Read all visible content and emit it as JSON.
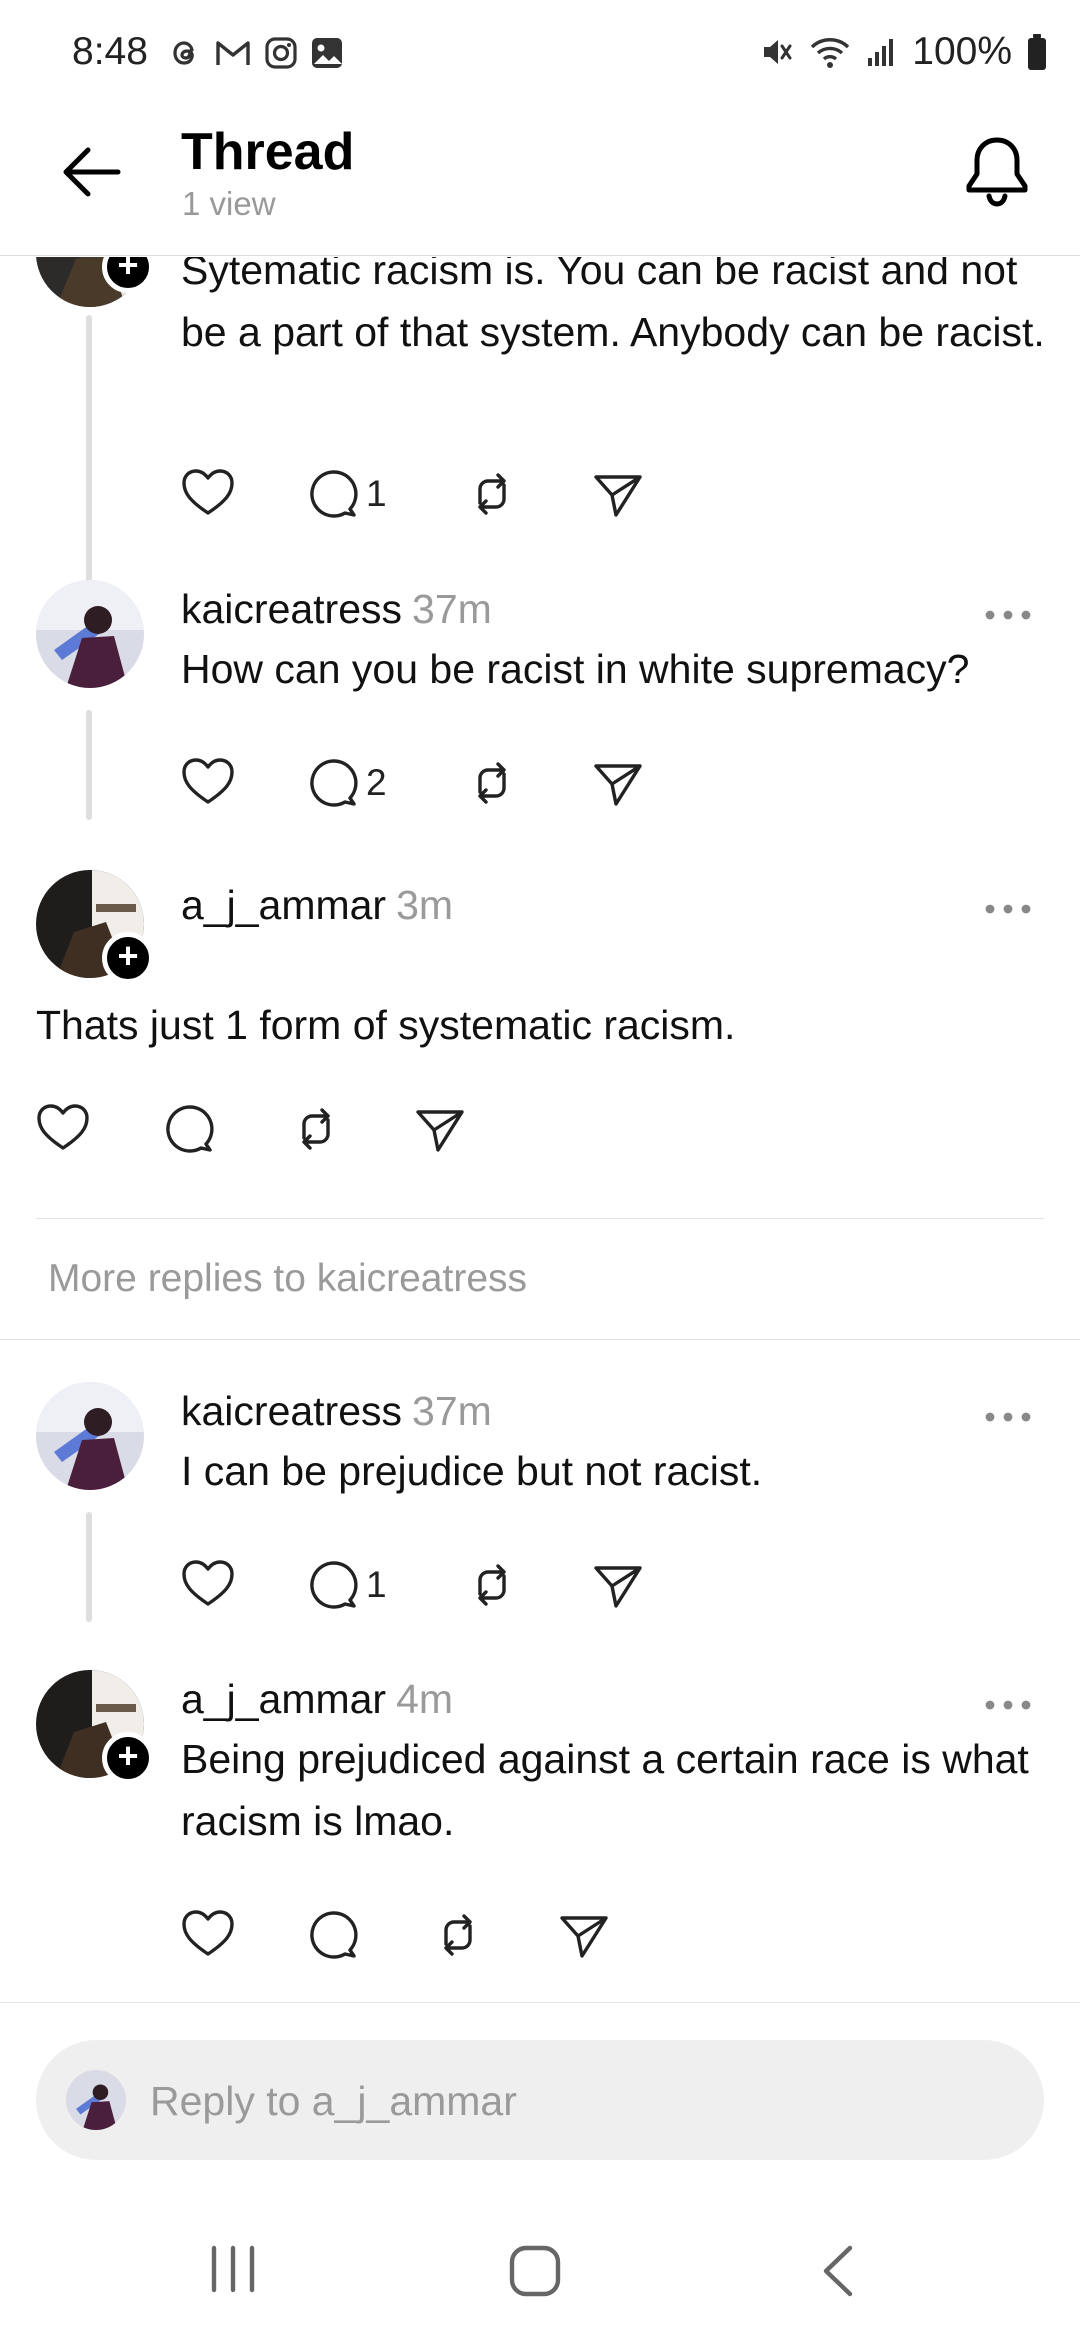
{
  "status_bar": {
    "time": "8:48",
    "battery": "100%",
    "left_icons": [
      "threads-icon",
      "gmail-icon",
      "instagram-icon",
      "gallery-icon"
    ],
    "right_icons": [
      "mute-icon",
      "wifi-icon",
      "signal-icon",
      "battery-icon"
    ]
  },
  "header": {
    "title": "Thread",
    "subtitle": "1 view"
  },
  "posts": [
    {
      "text": "Sytematic racism is. You can be racist and not be a part of that system. Anybody can be racist.",
      "reply_count": "1"
    },
    {
      "username": "kaicreatress",
      "time": "37m",
      "text": "How can you be racist in white supremacy?",
      "reply_count": "2"
    },
    {
      "username": "a_j_ammar",
      "time": "3m",
      "text": "Thats just 1 form of systematic racism.",
      "reply_count": ""
    },
    {
      "username": "kaicreatress",
      "time": "37m",
      "text": "I can be prejudice but not racist.",
      "reply_count": "1"
    },
    {
      "username": "a_j_ammar",
      "time": "4m",
      "text": "Being prejudiced against a certain race is what racism is lmao.",
      "reply_count": ""
    }
  ],
  "more_replies": "More replies to kaicreatress",
  "reply_bar": {
    "placeholder": "Reply to a_j_ammar"
  },
  "colors": {
    "text": "#111111",
    "muted": "#9a9a9a",
    "thread_line": "#dedede",
    "reply_box": "#efefef"
  }
}
